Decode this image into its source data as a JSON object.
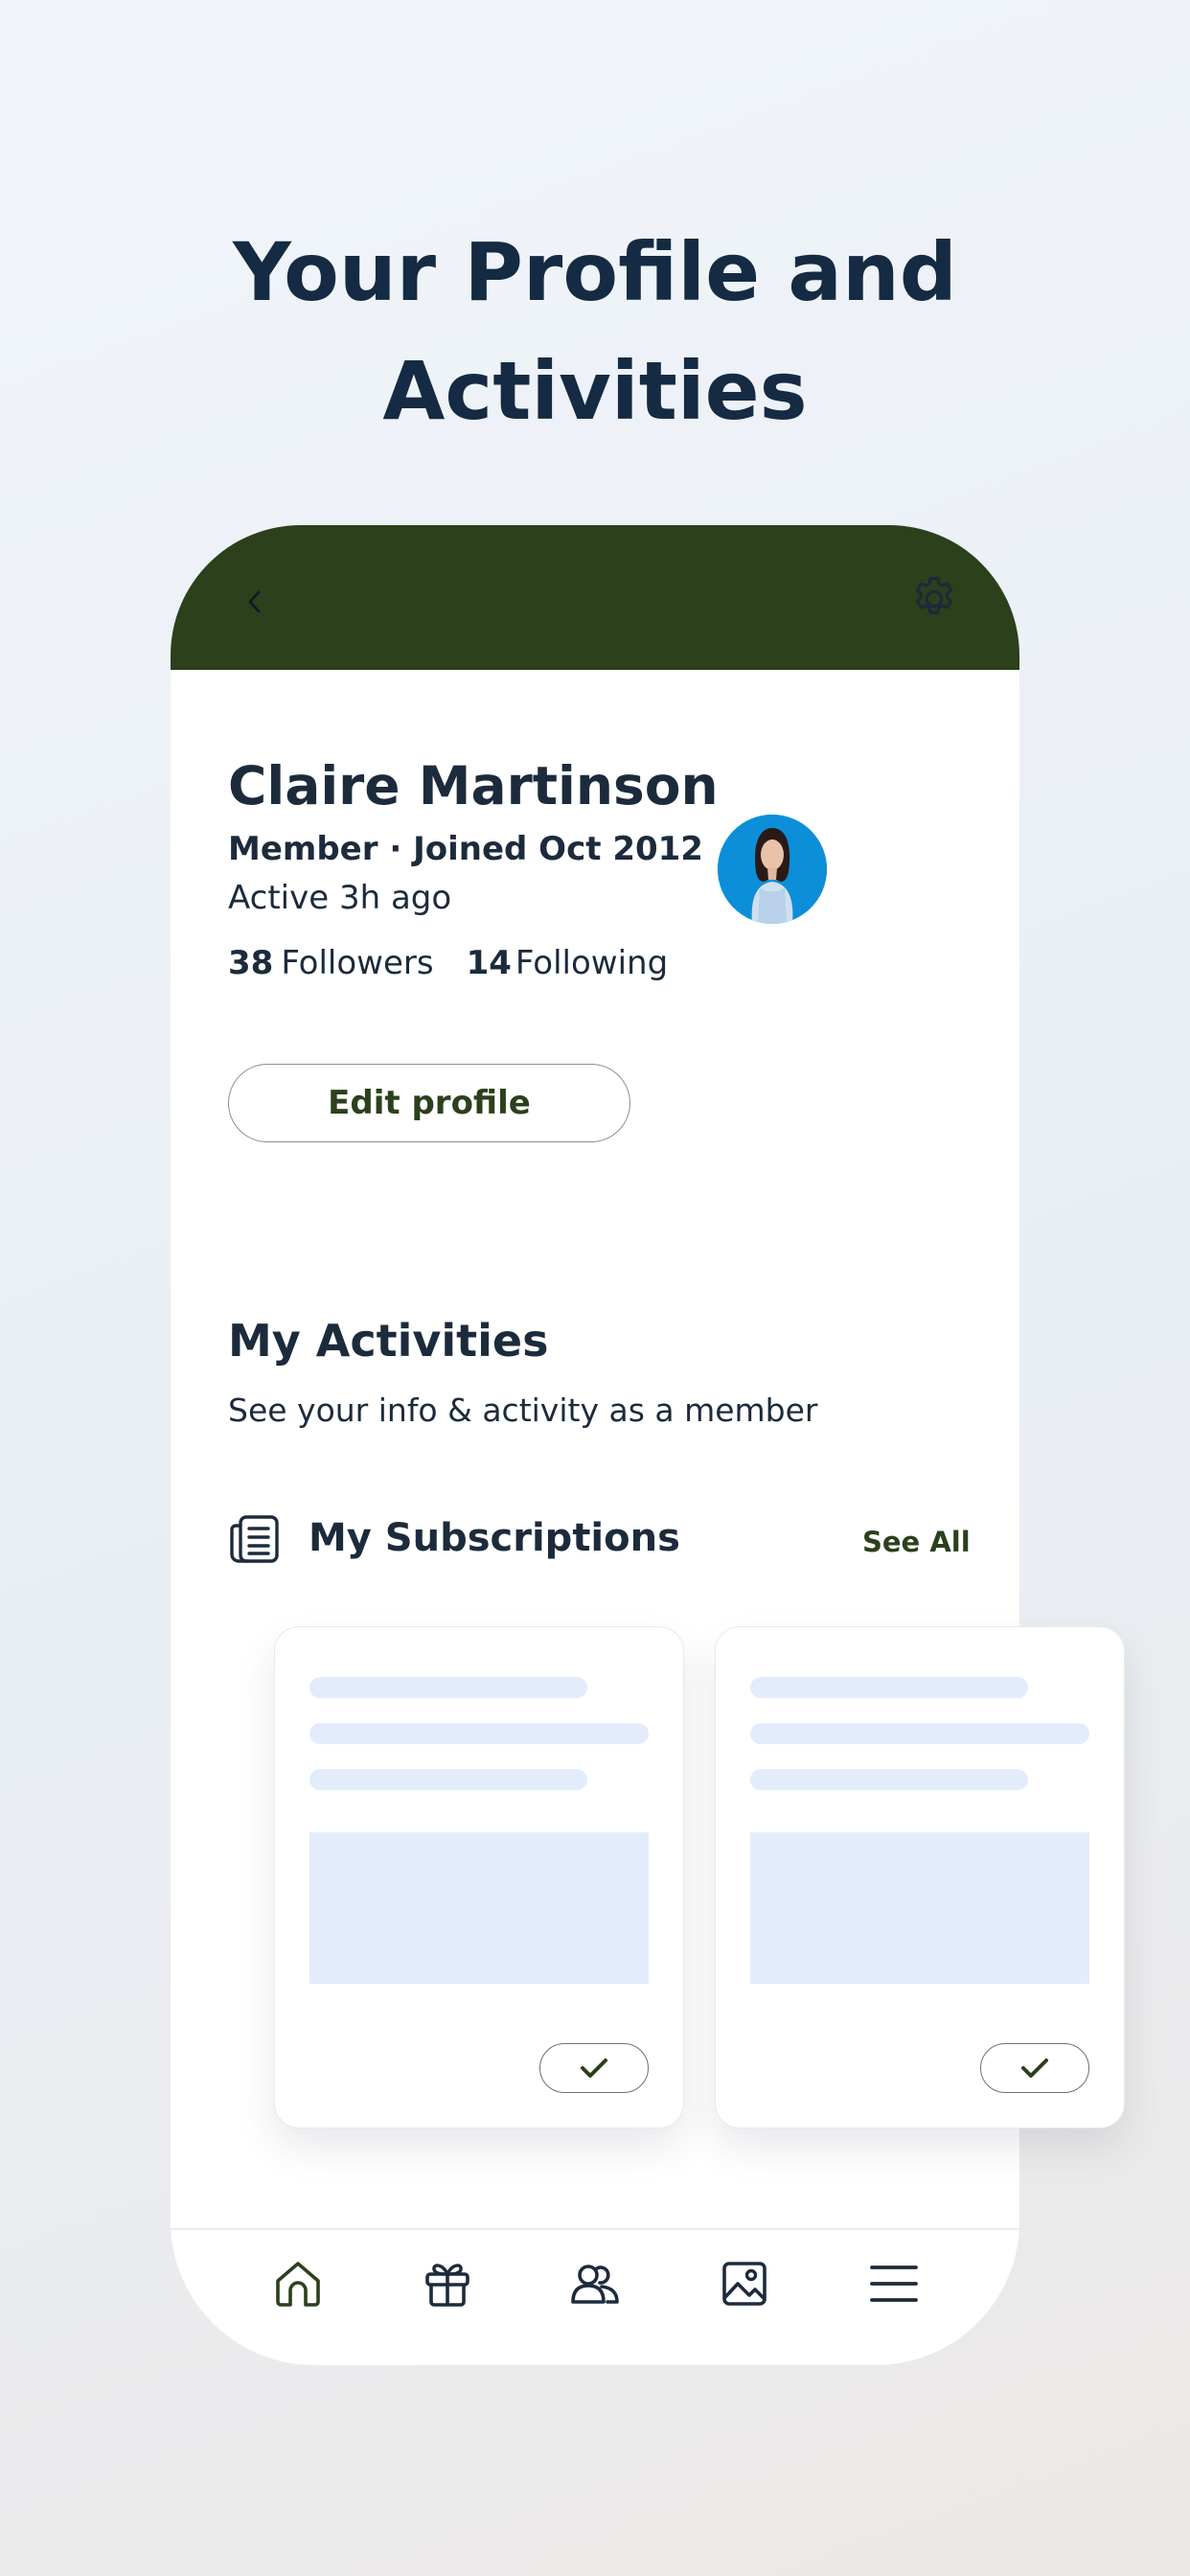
{
  "hero": {
    "title_line1": "Your Profile and",
    "title_line2": "Activities"
  },
  "header": {
    "back_icon": "chevron-left-icon",
    "settings_icon": "gear-icon",
    "background_color": "#2b401b"
  },
  "profile": {
    "name": "Claire Martinson",
    "meta": "Member · Joined Oct 2012",
    "active": "Active 3h ago",
    "followers_count": "38",
    "followers_label": "Followers",
    "following_count": "14",
    "following_label": "Following",
    "edit_label": "Edit profile"
  },
  "activities": {
    "title": "My Activities",
    "subtitle": "See your info & activity as a member"
  },
  "subscriptions": {
    "icon": "newspaper-icon",
    "title": "My Subscriptions",
    "see_all": "See All",
    "cards": [
      {
        "check_icon": "check-icon"
      },
      {
        "check_icon": "check-icon"
      }
    ]
  },
  "bottom_nav": {
    "items": [
      {
        "icon": "home-icon",
        "active": true
      },
      {
        "icon": "gift-icon",
        "active": false
      },
      {
        "icon": "community-icon",
        "active": false
      },
      {
        "icon": "image-icon",
        "active": false
      },
      {
        "icon": "menu-icon",
        "active": false
      }
    ]
  },
  "colors": {
    "accent": "#2b401b",
    "text": "#1c2b3c",
    "skeleton": "#e2ecfb"
  }
}
